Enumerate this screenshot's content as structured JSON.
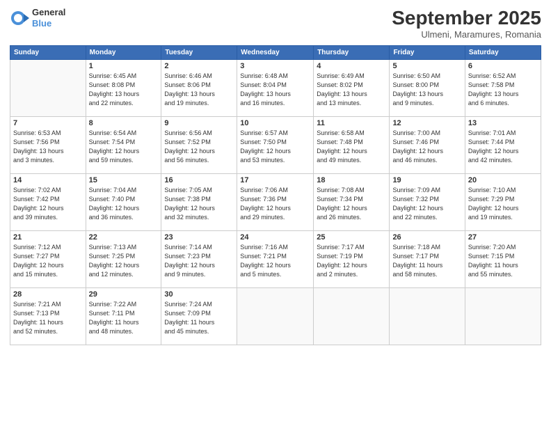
{
  "header": {
    "logo_line1": "General",
    "logo_line2": "Blue",
    "month": "September 2025",
    "location": "Ulmeni, Maramures, Romania"
  },
  "weekdays": [
    "Sunday",
    "Monday",
    "Tuesday",
    "Wednesday",
    "Thursday",
    "Friday",
    "Saturday"
  ],
  "weeks": [
    [
      {
        "day": "",
        "info": ""
      },
      {
        "day": "1",
        "info": "Sunrise: 6:45 AM\nSunset: 8:08 PM\nDaylight: 13 hours\nand 22 minutes."
      },
      {
        "day": "2",
        "info": "Sunrise: 6:46 AM\nSunset: 8:06 PM\nDaylight: 13 hours\nand 19 minutes."
      },
      {
        "day": "3",
        "info": "Sunrise: 6:48 AM\nSunset: 8:04 PM\nDaylight: 13 hours\nand 16 minutes."
      },
      {
        "day": "4",
        "info": "Sunrise: 6:49 AM\nSunset: 8:02 PM\nDaylight: 13 hours\nand 13 minutes."
      },
      {
        "day": "5",
        "info": "Sunrise: 6:50 AM\nSunset: 8:00 PM\nDaylight: 13 hours\nand 9 minutes."
      },
      {
        "day": "6",
        "info": "Sunrise: 6:52 AM\nSunset: 7:58 PM\nDaylight: 13 hours\nand 6 minutes."
      }
    ],
    [
      {
        "day": "7",
        "info": "Sunrise: 6:53 AM\nSunset: 7:56 PM\nDaylight: 13 hours\nand 3 minutes."
      },
      {
        "day": "8",
        "info": "Sunrise: 6:54 AM\nSunset: 7:54 PM\nDaylight: 12 hours\nand 59 minutes."
      },
      {
        "day": "9",
        "info": "Sunrise: 6:56 AM\nSunset: 7:52 PM\nDaylight: 12 hours\nand 56 minutes."
      },
      {
        "day": "10",
        "info": "Sunrise: 6:57 AM\nSunset: 7:50 PM\nDaylight: 12 hours\nand 53 minutes."
      },
      {
        "day": "11",
        "info": "Sunrise: 6:58 AM\nSunset: 7:48 PM\nDaylight: 12 hours\nand 49 minutes."
      },
      {
        "day": "12",
        "info": "Sunrise: 7:00 AM\nSunset: 7:46 PM\nDaylight: 12 hours\nand 46 minutes."
      },
      {
        "day": "13",
        "info": "Sunrise: 7:01 AM\nSunset: 7:44 PM\nDaylight: 12 hours\nand 42 minutes."
      }
    ],
    [
      {
        "day": "14",
        "info": "Sunrise: 7:02 AM\nSunset: 7:42 PM\nDaylight: 12 hours\nand 39 minutes."
      },
      {
        "day": "15",
        "info": "Sunrise: 7:04 AM\nSunset: 7:40 PM\nDaylight: 12 hours\nand 36 minutes."
      },
      {
        "day": "16",
        "info": "Sunrise: 7:05 AM\nSunset: 7:38 PM\nDaylight: 12 hours\nand 32 minutes."
      },
      {
        "day": "17",
        "info": "Sunrise: 7:06 AM\nSunset: 7:36 PM\nDaylight: 12 hours\nand 29 minutes."
      },
      {
        "day": "18",
        "info": "Sunrise: 7:08 AM\nSunset: 7:34 PM\nDaylight: 12 hours\nand 26 minutes."
      },
      {
        "day": "19",
        "info": "Sunrise: 7:09 AM\nSunset: 7:32 PM\nDaylight: 12 hours\nand 22 minutes."
      },
      {
        "day": "20",
        "info": "Sunrise: 7:10 AM\nSunset: 7:29 PM\nDaylight: 12 hours\nand 19 minutes."
      }
    ],
    [
      {
        "day": "21",
        "info": "Sunrise: 7:12 AM\nSunset: 7:27 PM\nDaylight: 12 hours\nand 15 minutes."
      },
      {
        "day": "22",
        "info": "Sunrise: 7:13 AM\nSunset: 7:25 PM\nDaylight: 12 hours\nand 12 minutes."
      },
      {
        "day": "23",
        "info": "Sunrise: 7:14 AM\nSunset: 7:23 PM\nDaylight: 12 hours\nand 9 minutes."
      },
      {
        "day": "24",
        "info": "Sunrise: 7:16 AM\nSunset: 7:21 PM\nDaylight: 12 hours\nand 5 minutes."
      },
      {
        "day": "25",
        "info": "Sunrise: 7:17 AM\nSunset: 7:19 PM\nDaylight: 12 hours\nand 2 minutes."
      },
      {
        "day": "26",
        "info": "Sunrise: 7:18 AM\nSunset: 7:17 PM\nDaylight: 11 hours\nand 58 minutes."
      },
      {
        "day": "27",
        "info": "Sunrise: 7:20 AM\nSunset: 7:15 PM\nDaylight: 11 hours\nand 55 minutes."
      }
    ],
    [
      {
        "day": "28",
        "info": "Sunrise: 7:21 AM\nSunset: 7:13 PM\nDaylight: 11 hours\nand 52 minutes."
      },
      {
        "day": "29",
        "info": "Sunrise: 7:22 AM\nSunset: 7:11 PM\nDaylight: 11 hours\nand 48 minutes."
      },
      {
        "day": "30",
        "info": "Sunrise: 7:24 AM\nSunset: 7:09 PM\nDaylight: 11 hours\nand 45 minutes."
      },
      {
        "day": "",
        "info": ""
      },
      {
        "day": "",
        "info": ""
      },
      {
        "day": "",
        "info": ""
      },
      {
        "day": "",
        "info": ""
      }
    ]
  ]
}
